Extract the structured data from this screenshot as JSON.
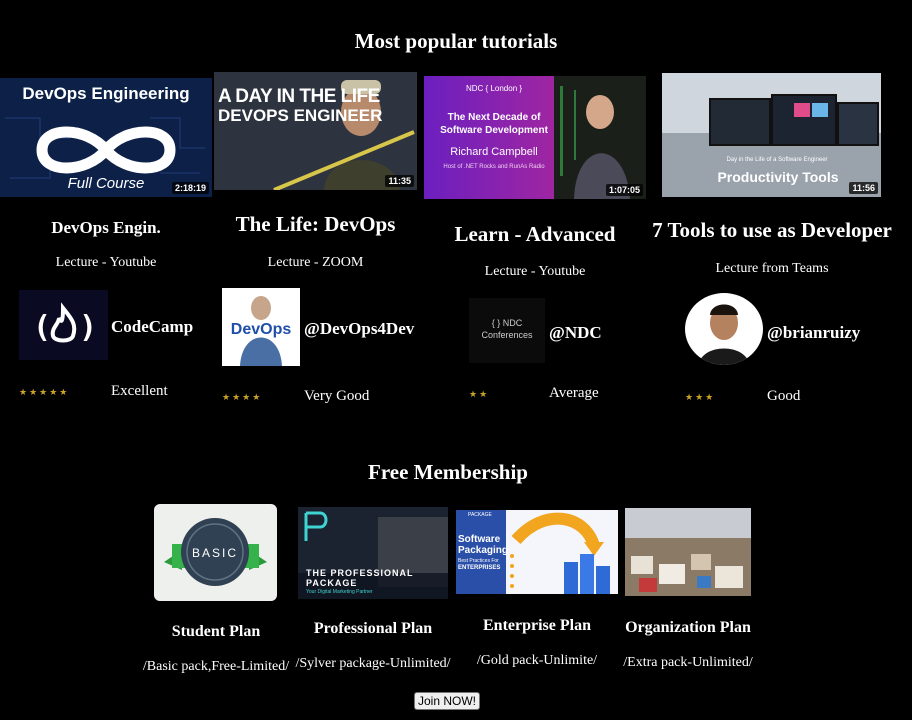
{
  "popular": {
    "heading": "Most popular tutorials",
    "tutorials": [
      {
        "title": "DevOps Engin.",
        "source": "Lecture - Youtube",
        "handle": "CodeCamp",
        "stars": "★★★★★",
        "rating": "Excellent",
        "thumb_title": "DevOps Engineering",
        "thumb_sub": "Full Course",
        "duration": "2:18:19"
      },
      {
        "title": "The Life: DevOps",
        "source": "Lecture - ZOOM",
        "handle": "@DevOps4Dev",
        "stars": "★★★★",
        "rating": "Very Good",
        "thumb_title_1": "A DAY IN THE LIFE",
        "thumb_title_2": "DEVOPS ENGINEER",
        "duration": "11:35",
        "avatar_text": "DevOps"
      },
      {
        "title": "Learn - Advanced",
        "source": "Lecture - Youtube",
        "handle": "@NDC",
        "stars": "★★",
        "rating": "Average",
        "thumb_tag": "NDC { London }",
        "thumb_title_1": "The Next Decade of",
        "thumb_title_2": "Software Development",
        "thumb_name": "Richard Campbell",
        "thumb_host": "Host of .NET Rocks and RunAs Radio",
        "duration": "1:07:05",
        "avatar_line1": "{ } NDC",
        "avatar_line2": "Conferences"
      },
      {
        "title": "7 Tools to use as Developer",
        "source": "Lecture from Teams",
        "handle": "@brianruizy",
        "stars": "★★★",
        "rating": "Good",
        "thumb_caption": "Day in the Life of a Software Engineer",
        "thumb_title": "Productivity Tools",
        "duration": "11:56"
      }
    ]
  },
  "membership": {
    "heading": "Free Membership",
    "plans": [
      {
        "title": "Student Plan",
        "desc": "/Basic pack,Free-Limited/",
        "badge": "BASIC"
      },
      {
        "title": "Professional Plan",
        "desc": "/Sylver package-Unlimited/",
        "img_line1": "THE PROFESSIONAL",
        "img_line2": "PACKAGE",
        "img_line3": "Your Digital Marketing Partner"
      },
      {
        "title": "Enterprise Plan",
        "desc": "/Gold pack-Unlimite/",
        "img_brand": "PACKAGE",
        "img_line1": "Software",
        "img_line2": "Packaging",
        "img_line3": "Best Practices For",
        "img_line4": "ENTERPRISES"
      },
      {
        "title": "Organization Plan",
        "desc": "/Extra pack-Unlimited/"
      }
    ],
    "join_label": "Join NOW!"
  },
  "colors": {
    "background": "#000000",
    "text": "#ffffff",
    "stars": "#c9a227"
  }
}
